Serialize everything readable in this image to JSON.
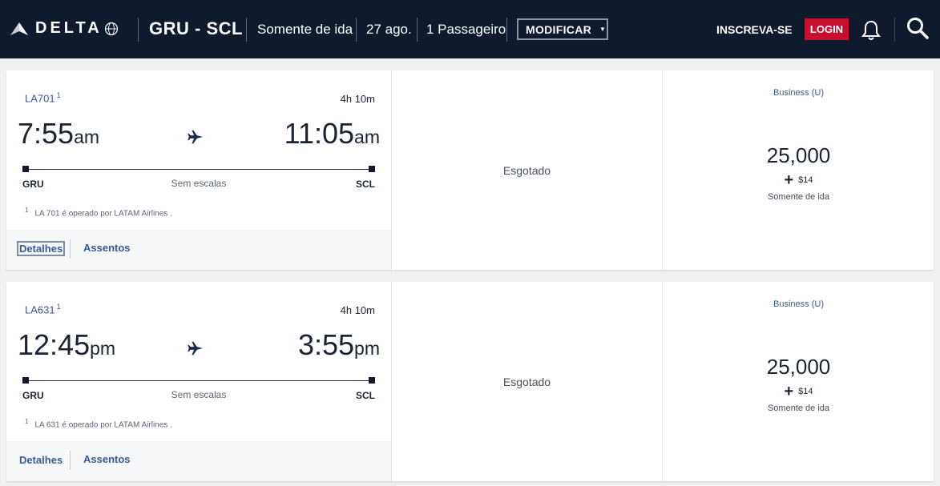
{
  "header": {
    "logo_text": "DELTA",
    "route": "GRU - SCL",
    "trip_type": "Somente de ida",
    "date": "27 ago.",
    "passengers": "1 Passageiro",
    "modify_label": "MODIFICAR",
    "signup_label": "INSCREVA-SE",
    "login_label": "LOGIN"
  },
  "flights": [
    {
      "flight_number": "LA701",
      "footnote_marker": "1",
      "duration": "4h 10m",
      "departure_time": "7:55",
      "departure_ampm": "am",
      "arrival_time": "11:05",
      "arrival_ampm": "am",
      "origin": "GRU",
      "destination": "SCL",
      "stops": "Sem escalas",
      "operated_note": "LA 701 é operado por LATAM Airlines .",
      "details_label": "Detalhes",
      "seats_label": "Assentos",
      "status": "Esgotado",
      "cabin": "Business (U)",
      "miles": "25,000",
      "fee": "$14",
      "trip_label": "Somente de ida"
    },
    {
      "flight_number": "LA631",
      "footnote_marker": "1",
      "duration": "4h 10m",
      "departure_time": "12:45",
      "departure_ampm": "pm",
      "arrival_time": "3:55",
      "arrival_ampm": "pm",
      "origin": "GRU",
      "destination": "SCL",
      "stops": "Sem escalas",
      "operated_note": "LA 631 é operado por LATAM Airlines .",
      "details_label": "Detalhes",
      "seats_label": "Assentos",
      "status": "Esgotado",
      "cabin": "Business (U)",
      "miles": "25,000",
      "fee": "$14",
      "trip_label": "Somente de ida"
    }
  ],
  "colors": {
    "header_bg": "#0f1a2c",
    "login_red": "#c8102e",
    "link_blue": "#3b5998"
  },
  "icons": [
    "delta-widget-icon",
    "globe-icon",
    "caret-down-icon",
    "bell-icon",
    "search-icon",
    "airplane-icon"
  ]
}
